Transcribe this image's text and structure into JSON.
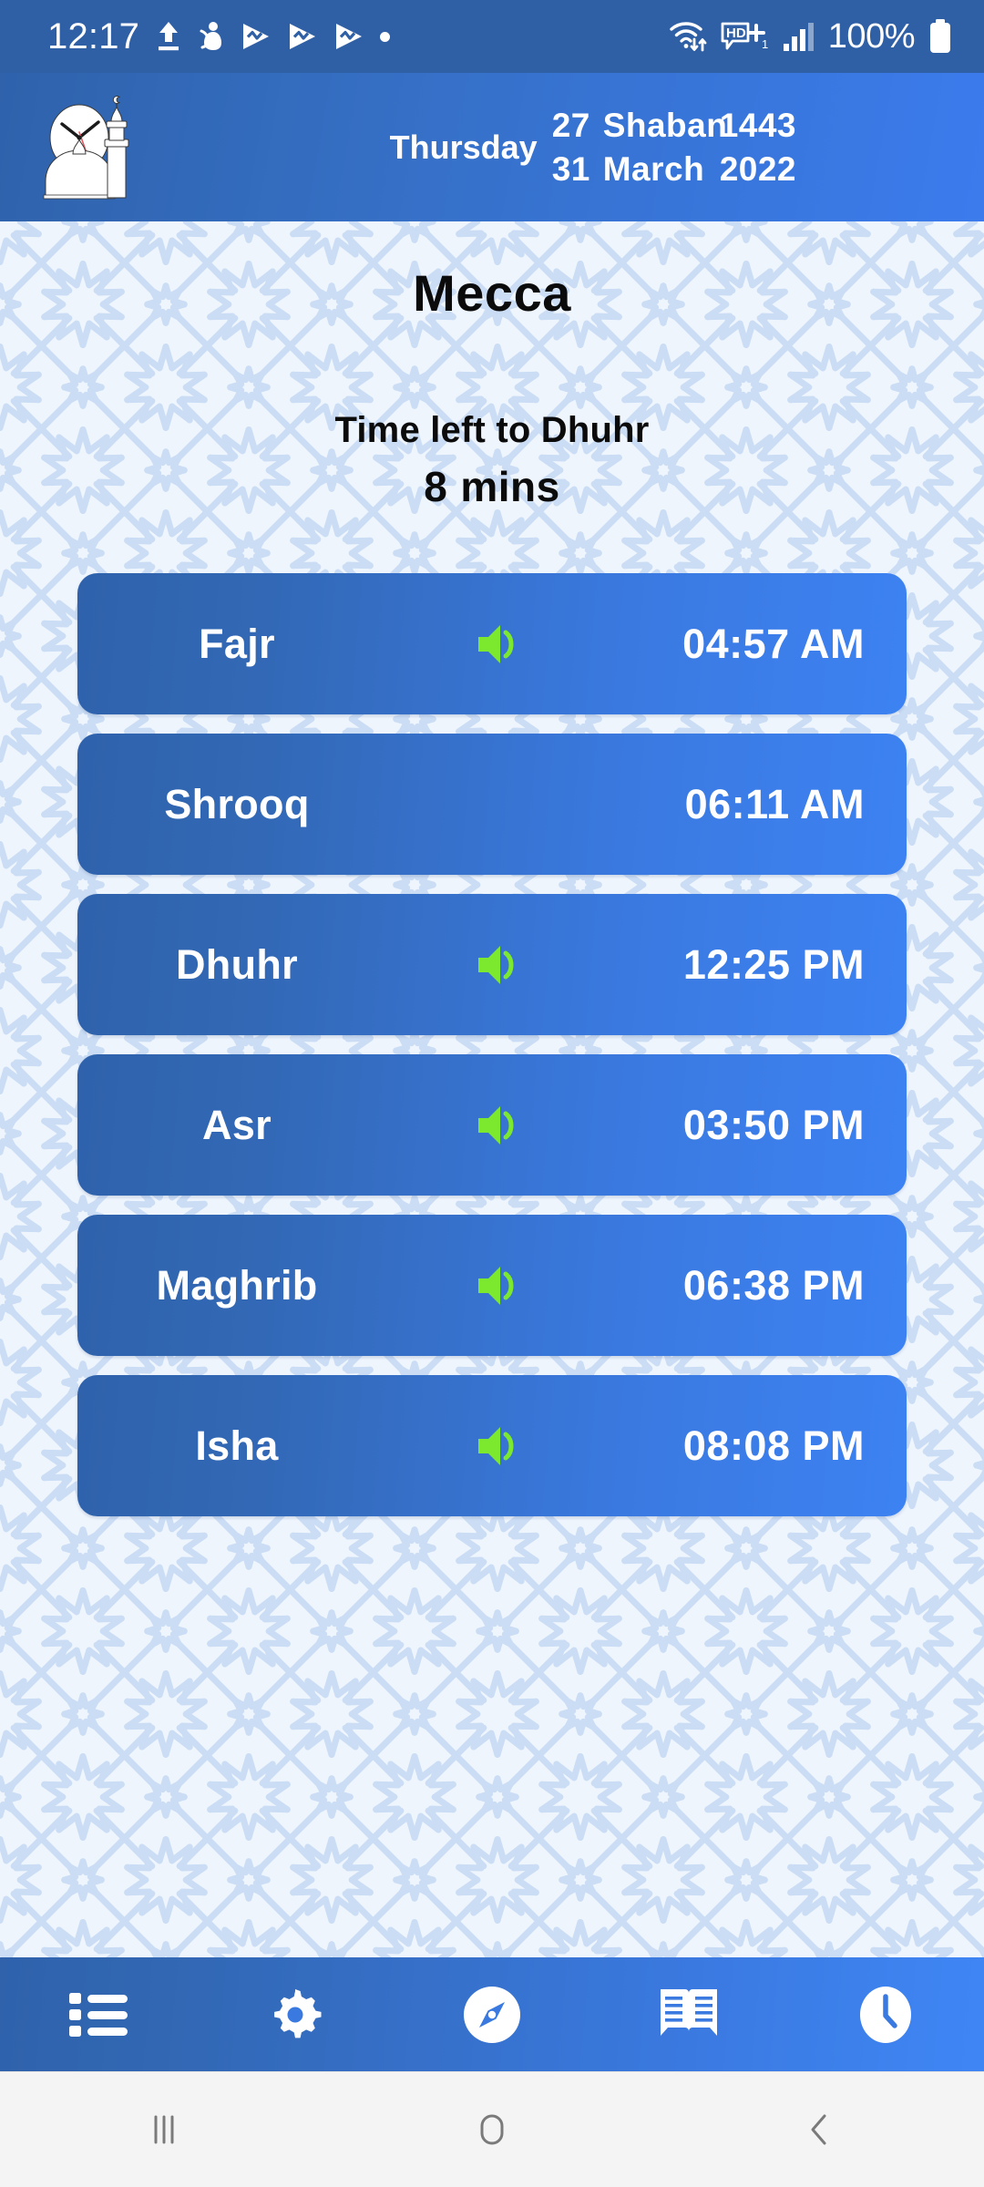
{
  "status_bar": {
    "time": "12:17",
    "battery_percent": "100%",
    "left_icons": [
      "upload-icon",
      "person-alert-icon",
      "play-triangle-icon",
      "play-triangle-icon",
      "play-triangle-icon",
      "dot-icon"
    ],
    "right_icons": [
      "wifi-transfer-icon",
      "hd-plus-icon",
      "signal-bars-icon",
      "battery-full-icon"
    ],
    "background_color": "#2f5fa5"
  },
  "header": {
    "logo_name": "mosque-clock-logo",
    "weekday": "Thursday",
    "hijri": {
      "day": "27",
      "month": "Shaban",
      "year": "1443"
    },
    "gregorian": {
      "day": "31",
      "month": "March",
      "year": "2022"
    },
    "gradient_start": "#2f62ab",
    "gradient_end": "#3b7bed"
  },
  "main": {
    "city": "Mecca",
    "countdown_label": "Time left to Dhuhr",
    "countdown_number": "8",
    "countdown_unit": "mins",
    "background_color": "#eff5fd",
    "pattern_color": "#c9ddf5"
  },
  "prayers": [
    {
      "name": "Fajr",
      "time": "04:57 AM",
      "has_alarm": true,
      "alarm_icon": "speaker-on-icon"
    },
    {
      "name": "Shrooq",
      "time": "06:11 AM",
      "has_alarm": false,
      "alarm_icon": ""
    },
    {
      "name": "Dhuhr",
      "time": "12:25 PM",
      "has_alarm": true,
      "alarm_icon": "speaker-on-icon"
    },
    {
      "name": "Asr",
      "time": "03:50 PM",
      "has_alarm": true,
      "alarm_icon": "speaker-on-icon"
    },
    {
      "name": "Maghrib",
      "time": "06:38 PM",
      "has_alarm": true,
      "alarm_icon": "speaker-on-icon"
    },
    {
      "name": "Isha",
      "time": "08:08 PM",
      "has_alarm": true,
      "alarm_icon": "speaker-on-icon"
    }
  ],
  "prayer_row_style": {
    "gradient_start": "#2f62ab",
    "gradient_end": "#3d82f2",
    "text_color": "#ffffff",
    "alarm_color": "#7ce82e"
  },
  "bottom_nav": [
    {
      "id": "list",
      "icon": "list-icon"
    },
    {
      "id": "settings",
      "icon": "gear-icon"
    },
    {
      "id": "qibla",
      "icon": "compass-icon"
    },
    {
      "id": "quran",
      "icon": "book-icon"
    },
    {
      "id": "times",
      "icon": "clock-icon"
    }
  ],
  "system_nav": [
    {
      "id": "recents",
      "icon": "recents-icon"
    },
    {
      "id": "home",
      "icon": "home-icon"
    },
    {
      "id": "back",
      "icon": "back-icon"
    }
  ]
}
